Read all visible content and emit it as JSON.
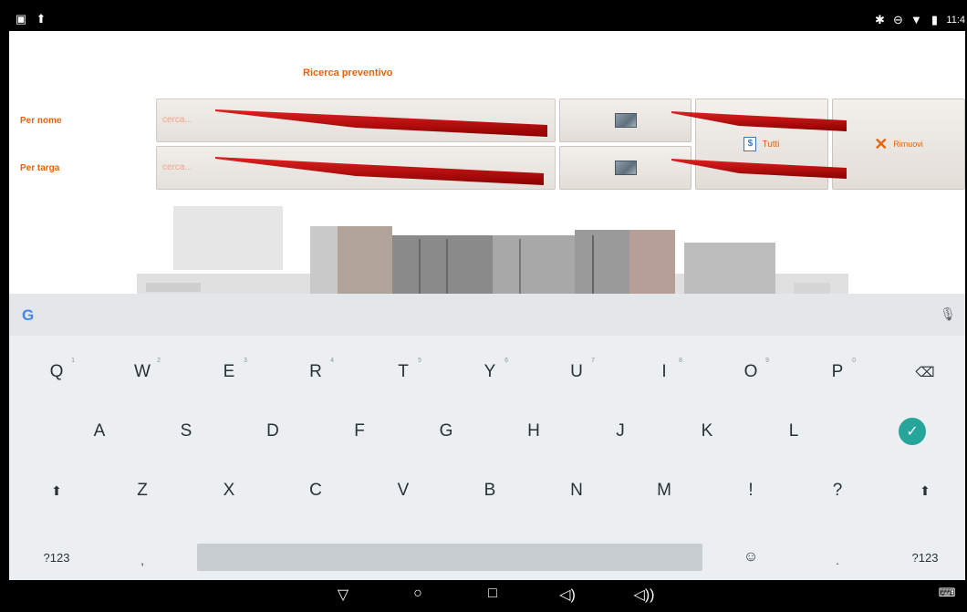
{
  "status_bar": {
    "time": "11:4",
    "left_icons": [
      "image-icon",
      "upload-icon"
    ],
    "right_icons": [
      "bluetooth-icon",
      "do-not-disturb-icon",
      "wifi-icon",
      "battery-icon"
    ]
  },
  "app": {
    "title": "Ricerca preventivo",
    "rows": [
      {
        "label": "Per nome",
        "placeholder": "cerca..."
      },
      {
        "label": "Per targa",
        "placeholder": "cerca..."
      }
    ],
    "tutti_label": "Tutti",
    "rimuovi_label": "Rimuovi",
    "accent_color": "#e8640c"
  },
  "keyboard": {
    "row1": [
      {
        "key": "Q",
        "hint": "1"
      },
      {
        "key": "W",
        "hint": "2"
      },
      {
        "key": "E",
        "hint": "3"
      },
      {
        "key": "R",
        "hint": "4"
      },
      {
        "key": "T",
        "hint": "5"
      },
      {
        "key": "Y",
        "hint": "6"
      },
      {
        "key": "U",
        "hint": "7"
      },
      {
        "key": "I",
        "hint": "8"
      },
      {
        "key": "O",
        "hint": "9"
      },
      {
        "key": "P",
        "hint": "0"
      }
    ],
    "row2": [
      "A",
      "S",
      "D",
      "F",
      "G",
      "H",
      "J",
      "K",
      "L"
    ],
    "row3": [
      "Z",
      "X",
      "C",
      "V",
      "B",
      "N",
      "M",
      "!",
      "?"
    ],
    "symbols_label": "?123",
    "comma": ",",
    "period": ".",
    "shift_icon": "shift-icon",
    "backspace_icon": "backspace-icon",
    "enter_icon": "check-icon",
    "emoji_icon": "emoji-icon",
    "enter_color": "#26a69a"
  },
  "nav_bar": {
    "icons": [
      "back-icon",
      "home-icon",
      "recents-icon",
      "volume-down-icon",
      "volume-up-icon",
      "keyboard-icon"
    ]
  }
}
